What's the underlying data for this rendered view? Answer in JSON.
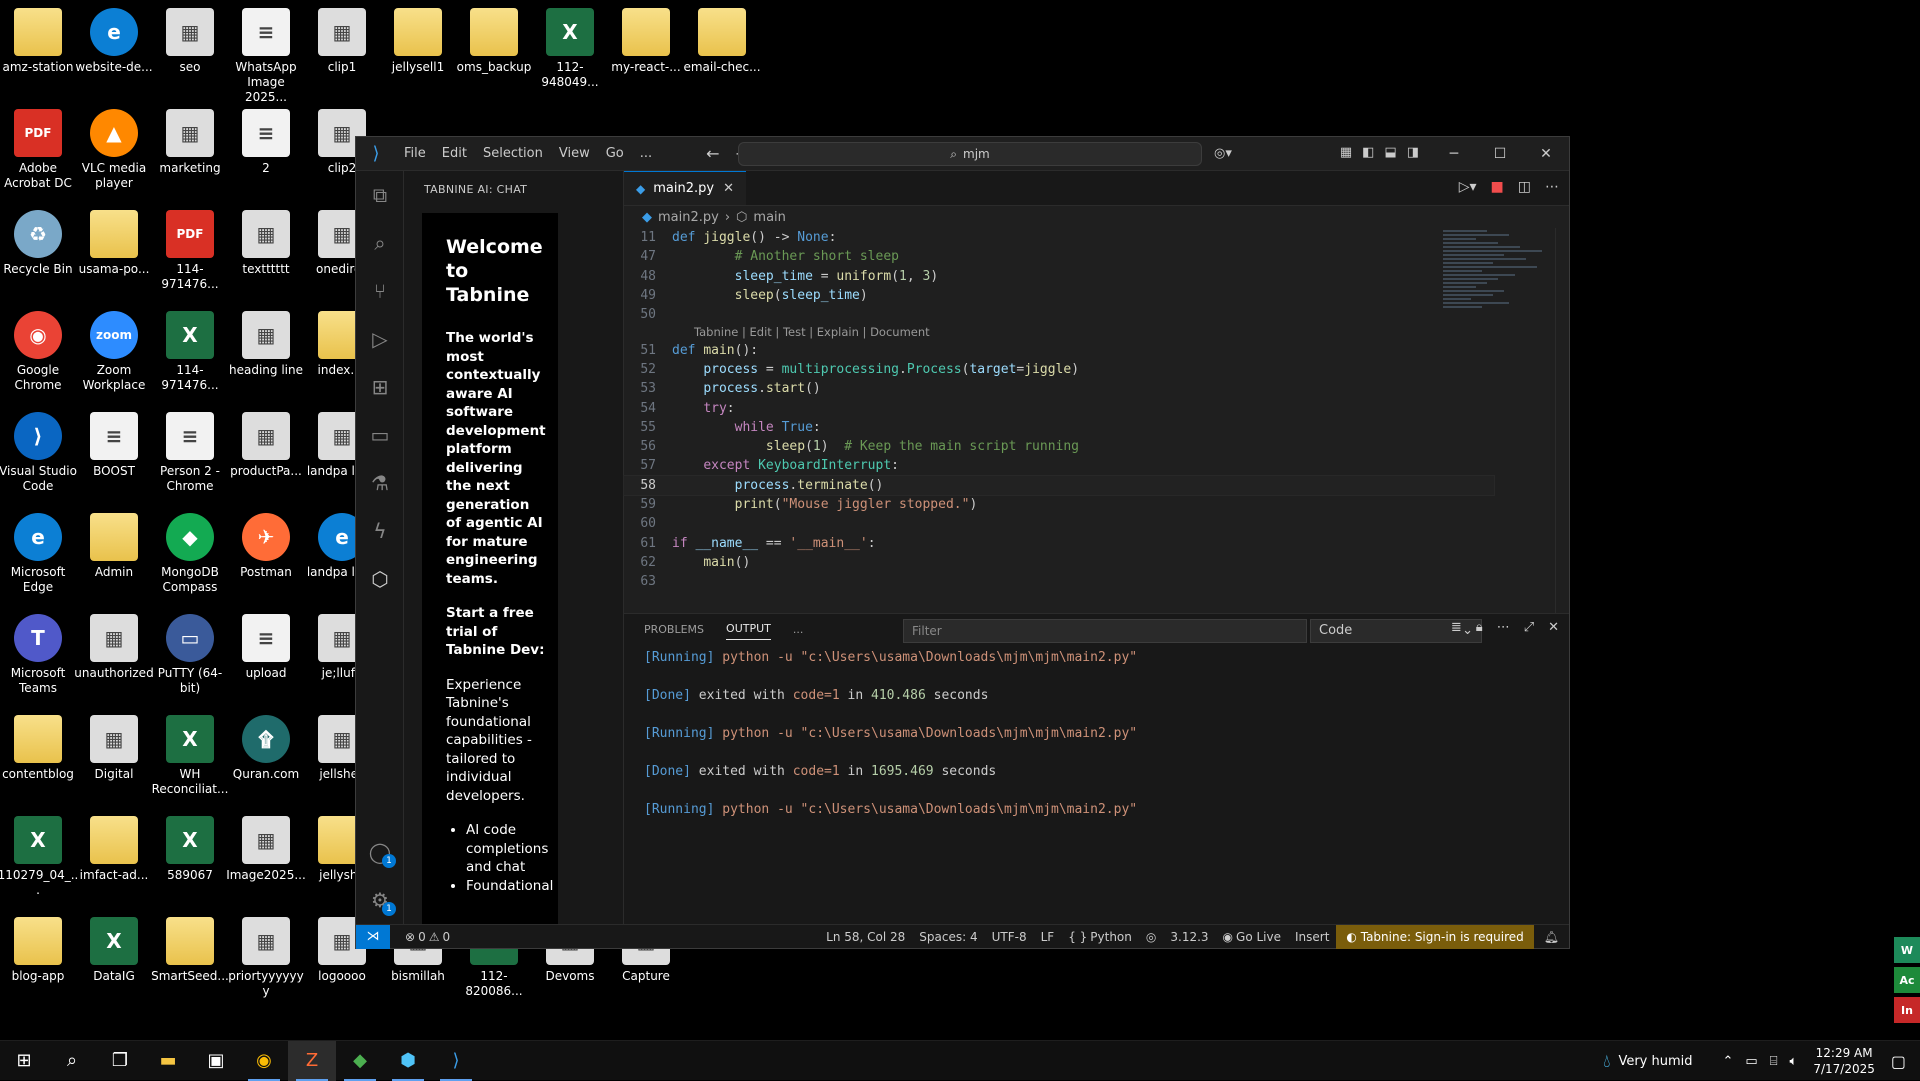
{
  "desktop": {
    "icons": [
      {
        "label": "amz-station",
        "x": 0,
        "y": 0,
        "type": "folder"
      },
      {
        "label": "website-de...",
        "x": 1,
        "y": 0,
        "type": "edge"
      },
      {
        "label": "seo",
        "x": 2,
        "y": 0,
        "type": "img"
      },
      {
        "label": "WhatsApp Image 2025...",
        "x": 3,
        "y": 0,
        "type": "doc"
      },
      {
        "label": "clip1",
        "x": 4,
        "y": 0,
        "type": "img"
      },
      {
        "label": "jellysell1",
        "x": 5,
        "y": 0,
        "type": "folder"
      },
      {
        "label": "oms_backup",
        "x": 6,
        "y": 0,
        "type": "folder"
      },
      {
        "label": "112-948049...",
        "x": 7,
        "y": 0,
        "type": "xls"
      },
      {
        "label": "my-react-...",
        "x": 8,
        "y": 0,
        "type": "folder"
      },
      {
        "label": "email-chec...",
        "x": 9,
        "y": 0,
        "type": "folder"
      },
      {
        "label": "Adobe Acrobat DC",
        "x": 0,
        "y": 1,
        "type": "pdf"
      },
      {
        "label": "VLC media player",
        "x": 1,
        "y": 1,
        "type": "vlc"
      },
      {
        "label": "marketing",
        "x": 2,
        "y": 1,
        "type": "img"
      },
      {
        "label": "2",
        "x": 3,
        "y": 1,
        "type": "doc"
      },
      {
        "label": "clip2",
        "x": 4,
        "y": 1,
        "type": "img"
      },
      {
        "label": "Recycle Bin",
        "x": 0,
        "y": 2,
        "type": "bin"
      },
      {
        "label": "usama-po...",
        "x": 1,
        "y": 2,
        "type": "folder"
      },
      {
        "label": "114-971476...",
        "x": 2,
        "y": 2,
        "type": "pdf"
      },
      {
        "label": "textttttt",
        "x": 3,
        "y": 2,
        "type": "img"
      },
      {
        "label": "onedirec",
        "x": 4,
        "y": 2,
        "type": "img"
      },
      {
        "label": "Google Chrome",
        "x": 0,
        "y": 3,
        "type": "chrome"
      },
      {
        "label": "Zoom Workplace",
        "x": 1,
        "y": 3,
        "type": "zoom"
      },
      {
        "label": "114-971476...",
        "x": 2,
        "y": 3,
        "type": "xls"
      },
      {
        "label": "heading line",
        "x": 3,
        "y": 3,
        "type": "img"
      },
      {
        "label": "index.ht",
        "x": 4,
        "y": 3,
        "type": "folder"
      },
      {
        "label": "Visual Studio Code",
        "x": 0,
        "y": 4,
        "type": "vscode"
      },
      {
        "label": "BOOST",
        "x": 1,
        "y": 4,
        "type": "doc"
      },
      {
        "label": "Person 2 - Chrome",
        "x": 2,
        "y": 4,
        "type": "doc"
      },
      {
        "label": "productPa...",
        "x": 3,
        "y": 4,
        "type": "img"
      },
      {
        "label": "landpa logo",
        "x": 4,
        "y": 4,
        "type": "img"
      },
      {
        "label": "Microsoft Edge",
        "x": 0,
        "y": 5,
        "type": "edge"
      },
      {
        "label": "Admin",
        "x": 1,
        "y": 5,
        "type": "folder"
      },
      {
        "label": "MongoDB Compass",
        "x": 2,
        "y": 5,
        "type": "mongo"
      },
      {
        "label": "Postman",
        "x": 3,
        "y": 5,
        "type": "postman"
      },
      {
        "label": "landpa logo",
        "x": 4,
        "y": 5,
        "type": "edge"
      },
      {
        "label": "Microsoft Teams",
        "x": 0,
        "y": 6,
        "type": "teams"
      },
      {
        "label": "unauthorized",
        "x": 1,
        "y": 6,
        "type": "img"
      },
      {
        "label": "PuTTY (64-bit)",
        "x": 2,
        "y": 6,
        "type": "putty"
      },
      {
        "label": "upload",
        "x": 3,
        "y": 6,
        "type": "doc"
      },
      {
        "label": "je;llufe",
        "x": 4,
        "y": 6,
        "type": "img"
      },
      {
        "label": "contentblog",
        "x": 0,
        "y": 7,
        "type": "folder"
      },
      {
        "label": "Digital",
        "x": 1,
        "y": 7,
        "type": "img"
      },
      {
        "label": "WH Reconciliat...",
        "x": 2,
        "y": 7,
        "type": "xls"
      },
      {
        "label": "Quran.com",
        "x": 3,
        "y": 7,
        "type": "quran"
      },
      {
        "label": "jellshell",
        "x": 4,
        "y": 7,
        "type": "img"
      },
      {
        "label": "110279_04_...",
        "x": 0,
        "y": 8,
        "type": "xls"
      },
      {
        "label": "imfact-ad...",
        "x": 1,
        "y": 8,
        "type": "folder"
      },
      {
        "label": "589067",
        "x": 2,
        "y": 8,
        "type": "xls"
      },
      {
        "label": "Image2025...",
        "x": 3,
        "y": 8,
        "type": "img"
      },
      {
        "label": "jellyshe",
        "x": 4,
        "y": 8,
        "type": "folder"
      },
      {
        "label": "blog-app",
        "x": 0,
        "y": 9,
        "type": "folder"
      },
      {
        "label": "DataIG",
        "x": 1,
        "y": 9,
        "type": "xls"
      },
      {
        "label": "SmartSeed...",
        "x": 2,
        "y": 9,
        "type": "folder"
      },
      {
        "label": "priortyyyyyyy",
        "x": 3,
        "y": 9,
        "type": "img"
      },
      {
        "label": "logoooo",
        "x": 4,
        "y": 9,
        "type": "img"
      },
      {
        "label": "bismillah",
        "x": 5,
        "y": 9,
        "type": "img"
      },
      {
        "label": "112-820086...",
        "x": 6,
        "y": 9,
        "type": "xls"
      },
      {
        "label": "Devoms",
        "x": 7,
        "y": 9,
        "type": "img"
      },
      {
        "label": "Capture",
        "x": 8,
        "y": 9,
        "type": "img"
      }
    ]
  },
  "vscode": {
    "menu": [
      "File",
      "Edit",
      "Selection",
      "View",
      "Go",
      "..."
    ],
    "search_text": "mjm",
    "sidebar_title": "TABNINE AI: CHAT",
    "chat": {
      "welcome": "Welcome to Tabnine",
      "intro": "The world's most contextually aware AI software development platform delivering the next generation of agentic AI for mature engineering teams.",
      "trial_title": "Start a free trial of Tabnine Dev:",
      "trial_body": "Experience Tabnine's foundational capabilities - tailored to individual developers.",
      "bullets": [
        "AI code completions and chat",
        "Foundational"
      ]
    },
    "tab": {
      "label": "main2.py",
      "close": "✕"
    },
    "breadcrumb": {
      "file": "main2.py",
      "symbol": "main"
    },
    "codelens": "Tabnine | Edit | Test | Explain | Document",
    "current_line": "58",
    "panel": {
      "tabs": [
        "PROBLEMS",
        "OUTPUT",
        "..."
      ],
      "filter_placeholder": "Filter",
      "channel": "Code",
      "output": [
        {
          "tag": "[Running]",
          "text": " python -u \"c:\\Users\\usama\\Downloads\\mjm\\mjm\\main2.py\""
        },
        {
          "tag": "[Done]",
          "text": " exited with ",
          "code": "code=1",
          "in": " in ",
          "secs": "410.486",
          "tail": " seconds"
        },
        {
          "tag": "[Running]",
          "text": " python -u \"c:\\Users\\usama\\Downloads\\mjm\\mjm\\main2.py\""
        },
        {
          "tag": "[Done]",
          "text": " exited with ",
          "code": "code=1",
          "in": " in ",
          "secs": "1695.469",
          "tail": " seconds"
        },
        {
          "tag": "[Running]",
          "text": " python -u \"c:\\Users\\usama\\Downloads\\mjm\\mjm\\main2.py\""
        }
      ]
    },
    "status": {
      "errors": "0",
      "warnings": "0",
      "position": "Ln 58, Col 28",
      "spaces": "Spaces: 4",
      "encoding": "UTF-8",
      "eol": "LF",
      "language": "Python",
      "python_version": "3.12.3",
      "golive": "Go Live",
      "mode": "Insert",
      "tabnine": "Tabnine: Sign-in is required"
    },
    "badges": {
      "accounts": "1",
      "manage": "1"
    }
  },
  "taskbar": {
    "weather": "Very humid",
    "time": "12:29 AM",
    "date": "7/17/2025"
  },
  "right_strip": [
    "W",
    "Ac",
    "In"
  ],
  "colors": {
    "accent": "#0078d4",
    "tabnine": "#7a5d0b"
  }
}
